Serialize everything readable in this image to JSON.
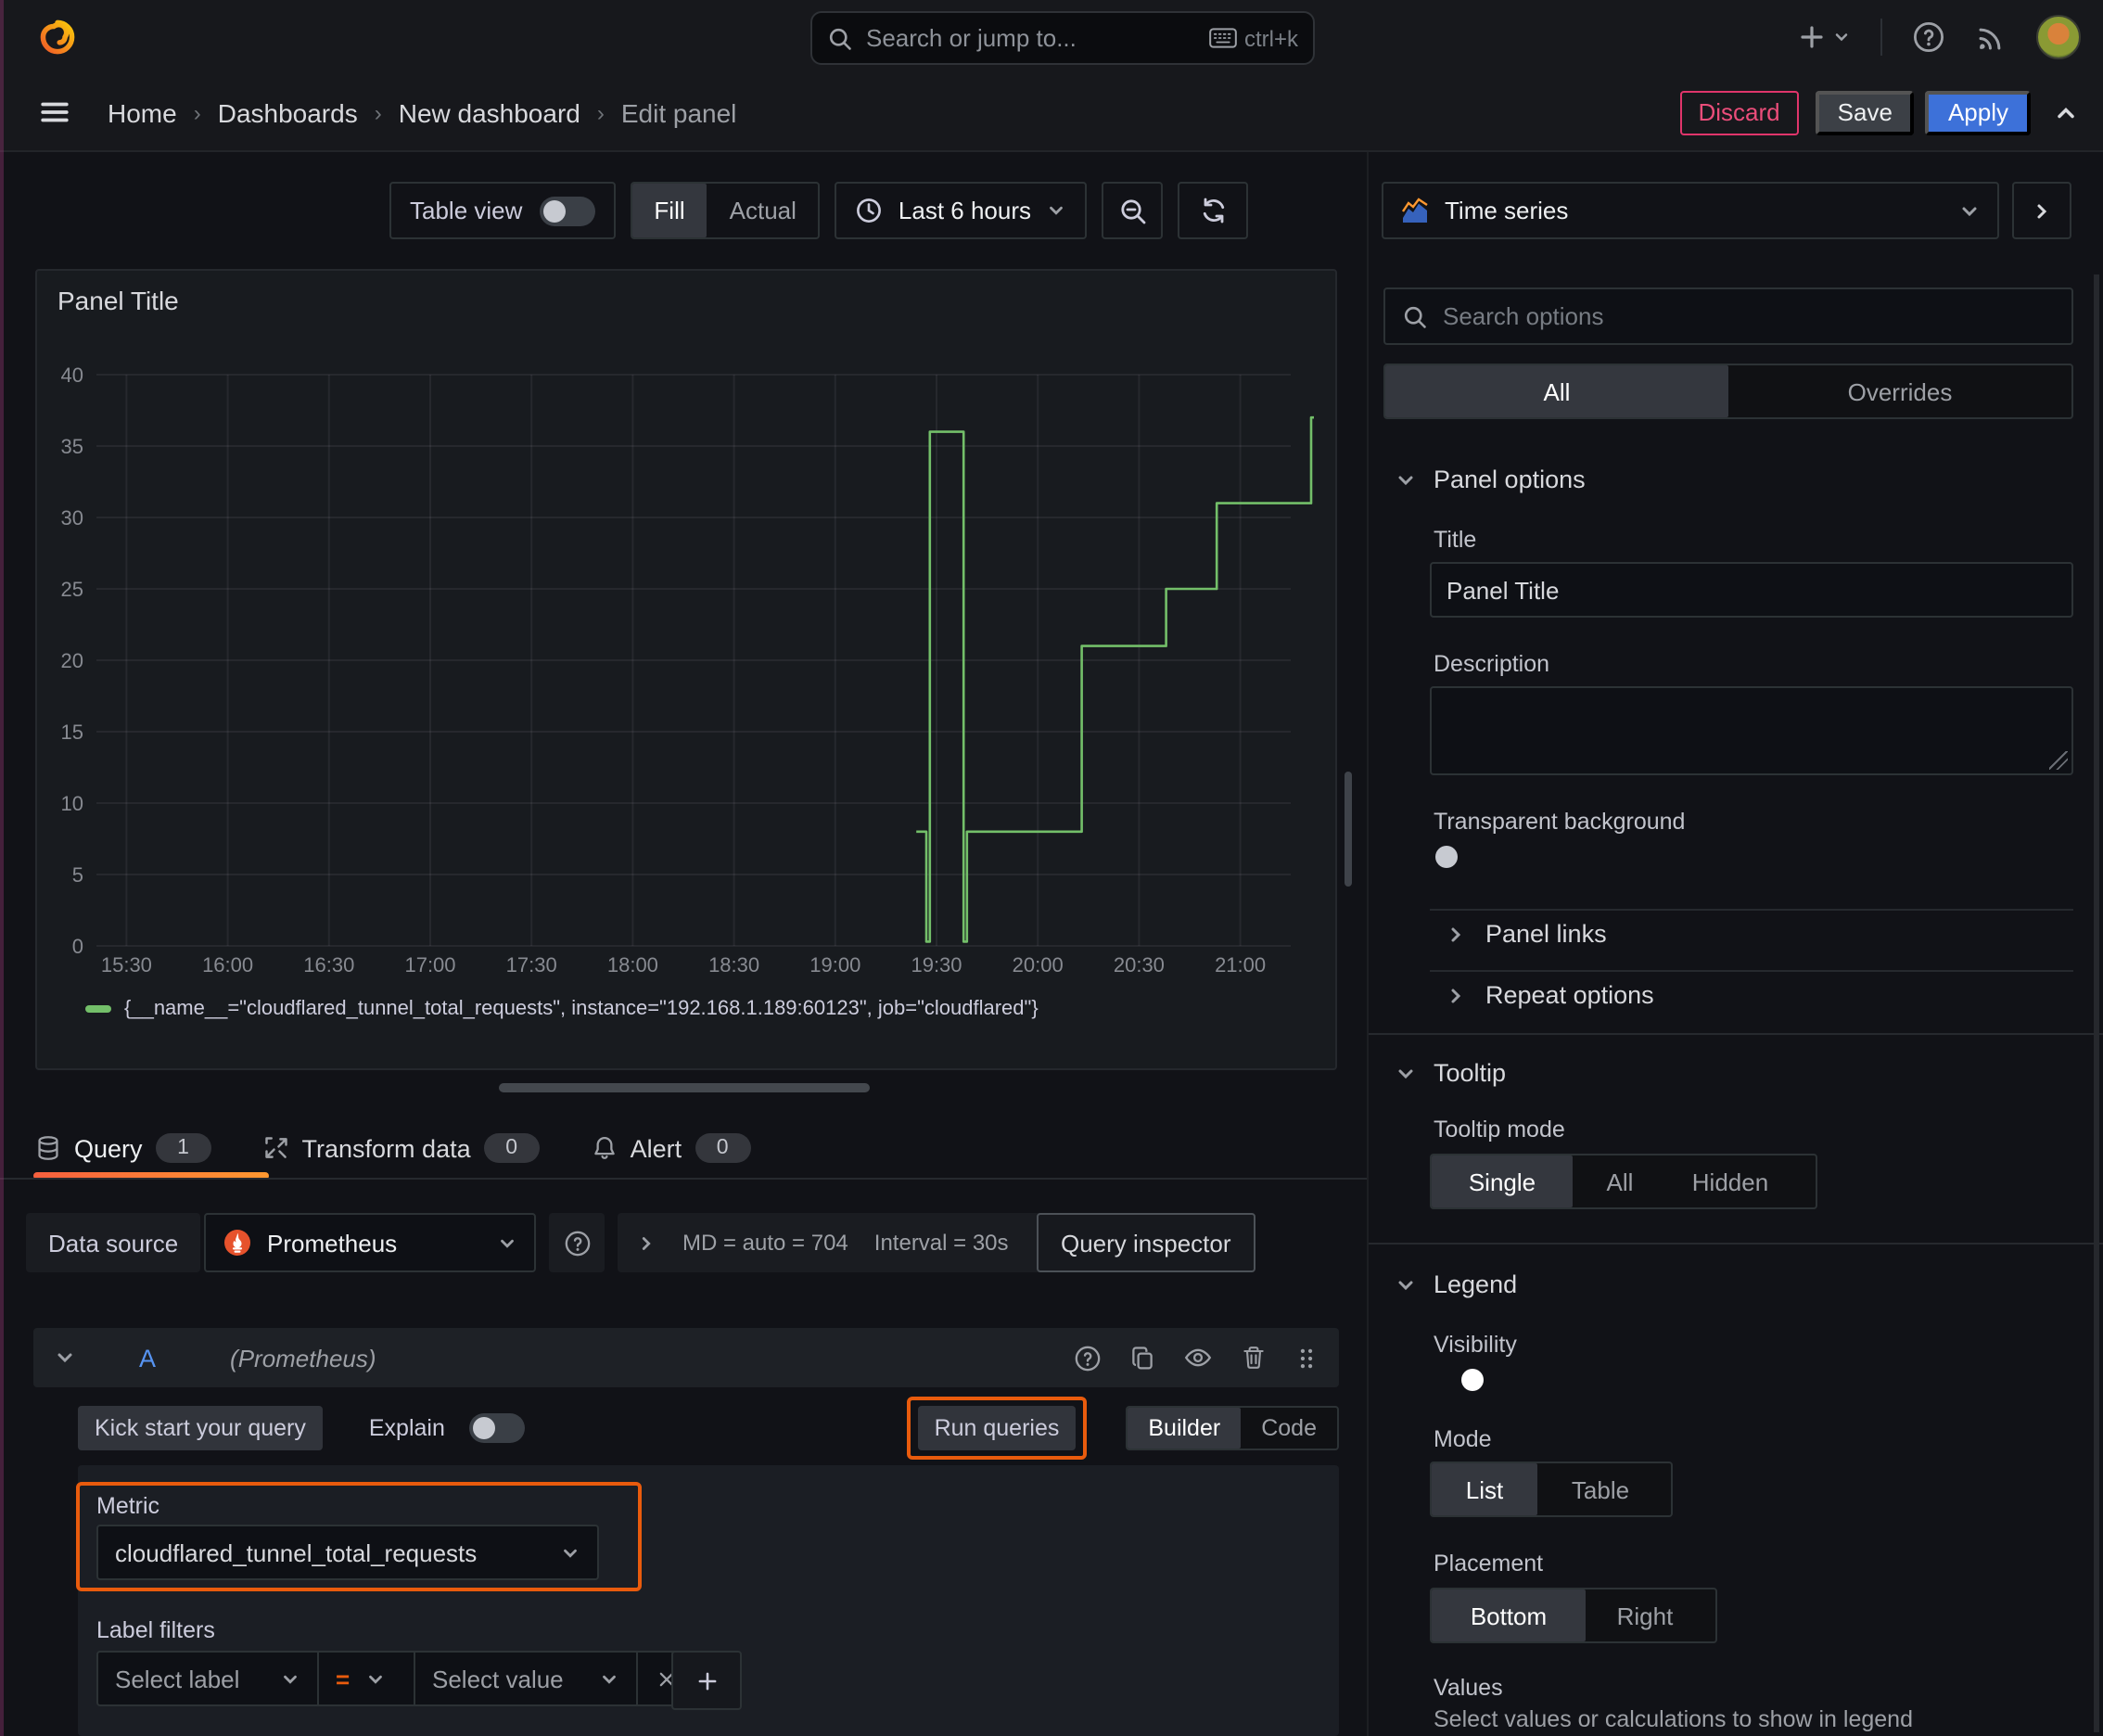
{
  "header": {
    "search_placeholder": "Search or jump to...",
    "search_shortcut": "ctrl+k"
  },
  "breadcrumb": {
    "items": [
      "Home",
      "Dashboards",
      "New dashboard",
      "Edit panel"
    ],
    "discard": "Discard",
    "save": "Save",
    "apply": "Apply"
  },
  "toolbar": {
    "table_view": "Table view",
    "fill": "Fill",
    "actual": "Actual",
    "time_range": "Last 6 hours"
  },
  "panel": {
    "title": "Panel Title"
  },
  "chart_data": {
    "type": "line",
    "line_interpolation": "step-after",
    "title": "Panel Title",
    "series_name": "{__name__=\"cloudflared_tunnel_total_requests\", instance=\"192.168.1.189:60123\", job=\"cloudflared\"}",
    "color": "#73bf69",
    "x_ticks": [
      "15:30",
      "16:00",
      "16:30",
      "17:00",
      "17:30",
      "18:00",
      "18:30",
      "19:00",
      "19:30",
      "20:00",
      "20:30",
      "21:00"
    ],
    "y_ticks": [
      0,
      5,
      10,
      15,
      20,
      25,
      30,
      35,
      40
    ],
    "ylim": [
      0,
      40
    ],
    "legend_position": "bottom",
    "grid": true,
    "points": [
      {
        "t": "19:24",
        "v": 8
      },
      {
        "t": "19:27",
        "v": 0.3
      },
      {
        "t": "19:28",
        "v": 36
      },
      {
        "t": "19:38",
        "v": 0.3
      },
      {
        "t": "19:39",
        "v": 8
      },
      {
        "t": "20:13",
        "v": 21
      },
      {
        "t": "20:38",
        "v": 25
      },
      {
        "t": "20:53",
        "v": 31
      },
      {
        "t": "21:21",
        "v": 37
      }
    ]
  },
  "query": {
    "tabs": [
      {
        "label": "Query",
        "badge": "1"
      },
      {
        "label": "Transform data",
        "badge": "0"
      },
      {
        "label": "Alert",
        "badge": "0"
      }
    ],
    "datasource_label": "Data source",
    "datasource": "Prometheus",
    "max_data_points": "MD = auto = 704",
    "interval": "Interval = 30s",
    "inspector": "Query inspector",
    "ref_id": "A",
    "ref_note": "(Prometheus)",
    "kick_start": "Kick start your query",
    "explain": "Explain",
    "run": "Run queries",
    "builder": "Builder",
    "code": "Code",
    "metric_label": "Metric",
    "metric": "cloudflared_tunnel_total_requests",
    "label_filters": "Label filters",
    "select_label": "Select label",
    "op": "=",
    "select_value": "Select value"
  },
  "sidebar": {
    "viz_type": "Time series",
    "search_placeholder": "Search options",
    "filter_tabs": [
      "All",
      "Overrides"
    ],
    "panel_options": {
      "header": "Panel options",
      "title_label": "Title",
      "title_value": "Panel Title",
      "description_label": "Description",
      "transparent_label": "Transparent background",
      "links": "Panel links",
      "repeat": "Repeat options"
    },
    "tooltip": {
      "header": "Tooltip",
      "mode_label": "Tooltip mode",
      "modes": [
        "Single",
        "All",
        "Hidden"
      ],
      "active_mode": "Single"
    },
    "legend": {
      "header": "Legend",
      "visibility_label": "Visibility",
      "mode_label": "Mode",
      "modes": [
        "List",
        "Table"
      ],
      "active_mode": "List",
      "placement_label": "Placement",
      "placements": [
        "Bottom",
        "Right"
      ],
      "active_placement": "Bottom",
      "values_label": "Values",
      "values_hint": "Select values or calculations to show in legend"
    }
  },
  "colors": {
    "accent_blue": "#3d71d9",
    "series_green": "#73bf69",
    "annotation_orange": "#e95b0d",
    "discard_red": "#e0356b",
    "tab_underline": "#ff8833",
    "background": "#111217",
    "panel_background": "#181b1f"
  }
}
